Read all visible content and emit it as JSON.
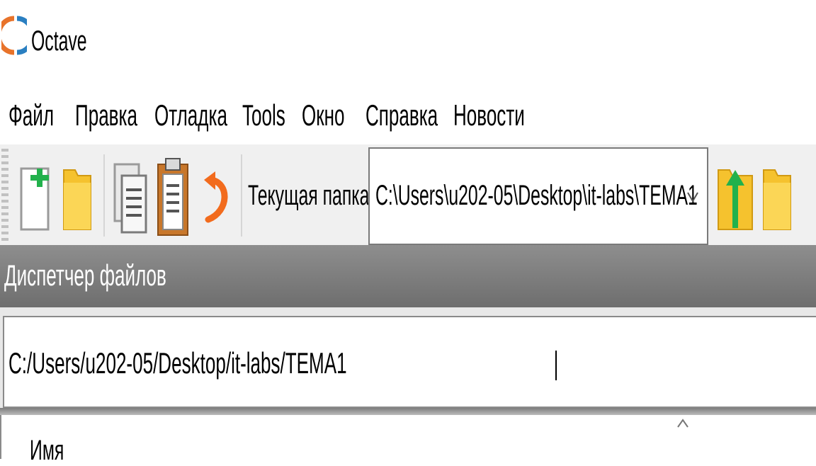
{
  "window": {
    "title": "Octave"
  },
  "menu": {
    "items": [
      "Файл",
      "Правка",
      "Отладка",
      "Tools",
      "Окно",
      "Справка",
      "Новости"
    ]
  },
  "toolbar": {
    "buttons": [
      "new-script-icon",
      "open-folder-icon",
      "copy-icon",
      "paste-icon",
      "undo-icon"
    ],
    "current_folder_label": "Текущая папка:",
    "current_folder_value": "C:\\Users\\u202-05\\Desktop\\it-labs\\TEMA1",
    "dropdown_icon": "chevron-down-icon",
    "extra_buttons": [
      "folder-up-icon",
      "browse-folder-icon"
    ]
  },
  "file_browser": {
    "title": "Диспетчер файлов",
    "path_value": "C:/Users/u202-05/Desktop/it-labs/TEMA1",
    "columns": [
      "Имя"
    ],
    "sort_icon": "sort-ascending-icon"
  },
  "colors": {
    "toolbar_bg": "#f0f0f0",
    "dock_header_bg": "#7e7e7e",
    "folder_yellow": "#f5c22e",
    "plus_green": "#22b14c",
    "undo_orange": "#f26b1d"
  }
}
